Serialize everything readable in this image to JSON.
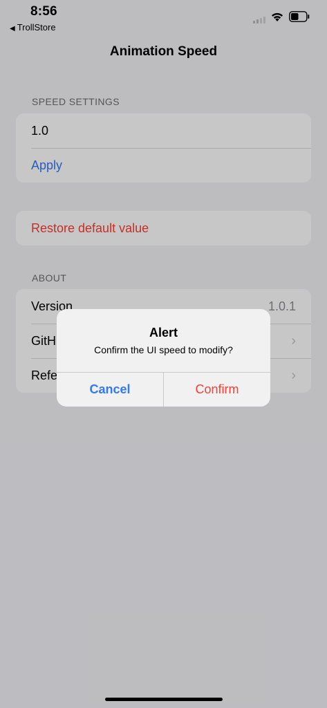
{
  "status_bar": {
    "time": "8:56",
    "back_app": "TrollStore",
    "back_icon": "back-triangle-icon",
    "battery_level": 0.5
  },
  "nav": {
    "title": "Animation Speed"
  },
  "speed_settings": {
    "header": "SPEED SETTINGS",
    "input_value": "1.0",
    "apply_label": "Apply"
  },
  "restore": {
    "label": "Restore default value"
  },
  "about": {
    "header": "ABOUT",
    "version_label": "Version",
    "version_value": "1.0.1",
    "github_label": "GitH",
    "reference_label": "Refe"
  },
  "alert": {
    "title": "Alert",
    "message": "Confirm the UI speed to modify?",
    "cancel_label": "Cancel",
    "confirm_label": "Confirm"
  },
  "colors": {
    "accent_blue": "#3478f6",
    "destructive_red": "#ff3b30",
    "background": "#f2f2f7"
  }
}
